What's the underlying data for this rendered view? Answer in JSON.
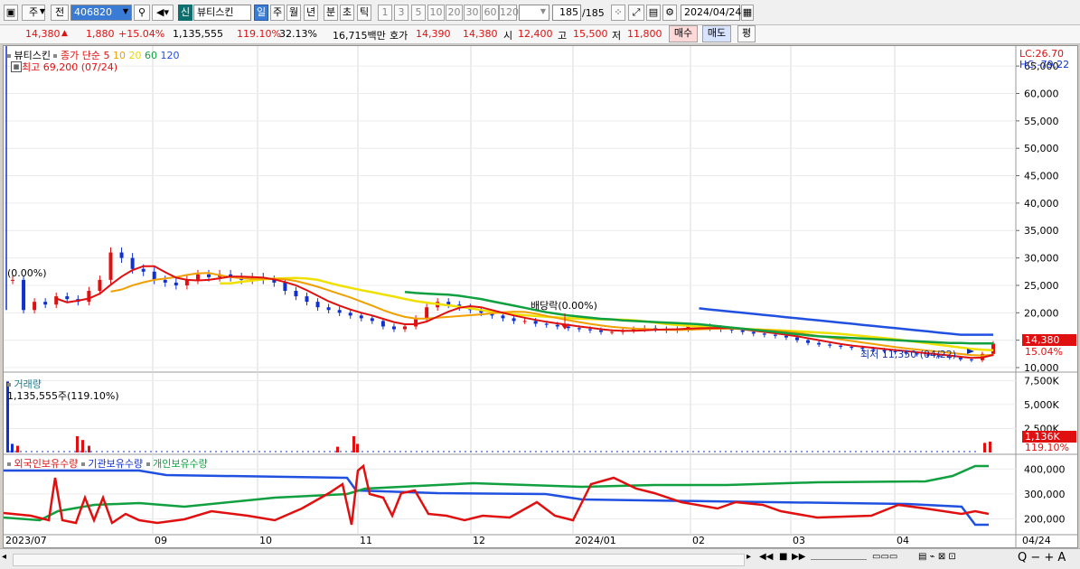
{
  "toolbar": {
    "market": "주",
    "market_type": "전",
    "code": "406820",
    "new_badge": "신",
    "stock_name": "뷰티스킨",
    "periods": [
      "일",
      "주",
      "월",
      "년",
      "분",
      "초",
      "틱"
    ],
    "active_period": "일",
    "intervals": [
      "1",
      "3",
      "5",
      "10",
      "20",
      "30",
      "60",
      "120"
    ],
    "count": "185",
    "count_total": "/185",
    "date": "2024/04/24"
  },
  "infobar": {
    "price": "14,380",
    "change": "1,880",
    "change_pct": "+15.04%",
    "volume": "1,135,555",
    "volume_ratio": "119.10%",
    "turnover": "32.13%",
    "amount": "16,715백만",
    "quote_label": "호가",
    "ask": "14,390",
    "bid": "14,380",
    "open_label": "시",
    "open": "12,400",
    "high_label": "고",
    "high": "15,500",
    "low_label": "저",
    "low": "11,800",
    "buy": "매수",
    "sell": "매도",
    "eval": "평"
  },
  "price_pane": {
    "legend_name": "뷰티스킨",
    "legend_ma": "종가 단순",
    "ma_periods": [
      "5",
      "10",
      "20",
      "60",
      "120"
    ],
    "ma_colors": [
      "#e01010",
      "#f0a000",
      "#f0e000",
      "#10a040",
      "#2050e0"
    ],
    "max_label": "최고 69,200 (07/24)",
    "min_label": "최저 11,350 (04/22)",
    "pct_marker": "(0.00%)",
    "dividend_label": "배당락(0.00%)",
    "lc": "LC:26.70",
    "hc": "HC:-79.22",
    "current_tag": "14,380",
    "current_pct": "15.04%"
  },
  "volume_pane": {
    "title": "거래량",
    "value": "1,135,555주(119.10%)",
    "current_tag": "1,136K",
    "current_pct": "119.10%"
  },
  "holding_pane": {
    "series": [
      "외국인보유수량",
      "기관보유수량",
      "개인보유수량"
    ],
    "colors": [
      "#e01010",
      "#2050e0",
      "#10a040"
    ]
  },
  "chart_data": [
    {
      "type": "candlestick",
      "y_ticks": [
        "65,000",
        "60,000",
        "55,000",
        "50,000",
        "45,000",
        "40,000",
        "35,000",
        "30,000",
        "25,000",
        "20,000",
        "15,000",
        "10,000"
      ],
      "ylim": [
        10000,
        67000
      ],
      "x_labels": [
        "2023/07",
        "09",
        "10",
        "11",
        "12",
        "2024/01",
        "02",
        "03",
        "04",
        "04/24"
      ],
      "close": [
        26000,
        20500,
        22000,
        21500,
        23000,
        22500,
        22000,
        24000,
        26000,
        31000,
        30000,
        28000,
        27500,
        26000,
        25500,
        25000,
        26000,
        27000,
        26500,
        27000,
        26500,
        26000,
        26500,
        26000,
        25500,
        24000,
        23000,
        22000,
        21000,
        20500,
        20000,
        19500,
        19000,
        18500,
        17500,
        17000,
        17500,
        19000,
        21000,
        22000,
        21500,
        21000,
        20500,
        20000,
        19500,
        19000,
        18500,
        18500,
        18000,
        17800,
        17500,
        17200,
        17000,
        16800,
        16500,
        16500,
        16800,
        17000,
        17200,
        17000,
        16800,
        17000,
        17500,
        17500,
        17200,
        17000,
        16800,
        16500,
        16200,
        16000,
        15800,
        15500,
        15000,
        14500,
        14200,
        14000,
        13800,
        13600,
        13400,
        13200,
        13000,
        12800,
        12600,
        12400,
        12200,
        12000,
        11800,
        11500,
        11350,
        12500,
        14380
      ],
      "ma60": [
        null,
        null,
        null,
        null,
        null,
        null,
        null,
        null,
        null,
        null,
        null,
        null,
        null,
        null,
        null,
        null,
        null,
        null,
        null,
        null,
        null,
        null,
        null,
        null,
        null,
        null,
        null,
        null,
        null,
        null,
        null,
        null,
        null,
        null,
        null,
        null,
        23800,
        23600,
        23500,
        23400,
        23300,
        23100,
        22800,
        22500,
        22100,
        21700,
        21300,
        20900,
        20500,
        20100,
        19800,
        19500,
        19300,
        19100,
        18900,
        18800,
        18600,
        18500,
        18400,
        18300,
        18200,
        18100,
        18000,
        17900,
        17700,
        17500,
        17300,
        17100,
        16900,
        16700,
        16500,
        16300,
        16100,
        15900,
        15700,
        15600,
        15500,
        15400,
        15300,
        15200,
        15100,
        15000,
        14900,
        14800,
        14700,
        14600,
        14500,
        14500,
        14400,
        14400,
        14400
      ],
      "ma120": [
        null,
        null,
        null,
        null,
        null,
        null,
        null,
        null,
        null,
        null,
        null,
        null,
        null,
        null,
        null,
        null,
        null,
        null,
        null,
        null,
        null,
        null,
        null,
        null,
        null,
        null,
        null,
        null,
        null,
        null,
        null,
        null,
        null,
        null,
        null,
        null,
        null,
        null,
        null,
        null,
        null,
        null,
        null,
        null,
        null,
        null,
        null,
        null,
        null,
        null,
        null,
        null,
        null,
        null,
        null,
        null,
        null,
        null,
        null,
        null,
        null,
        null,
        null,
        20800,
        20600,
        20400,
        20200,
        20000,
        19800,
        19600,
        19400,
        19200,
        19000,
        18800,
        18600,
        18400,
        18200,
        18000,
        17800,
        17600,
        17400,
        17200,
        17000,
        16800,
        16600,
        16400,
        16200,
        16000,
        16000,
        16000,
        16000
      ]
    },
    {
      "type": "bar",
      "title": "거래량",
      "y_ticks": [
        "7,500K",
        "5,000K",
        "2,500K"
      ],
      "ylim": [
        0,
        8000
      ]
    },
    {
      "type": "line",
      "y_ticks": [
        "400,000",
        "300,000",
        "200,000"
      ],
      "ylim": [
        140000,
        430000
      ]
    }
  ]
}
